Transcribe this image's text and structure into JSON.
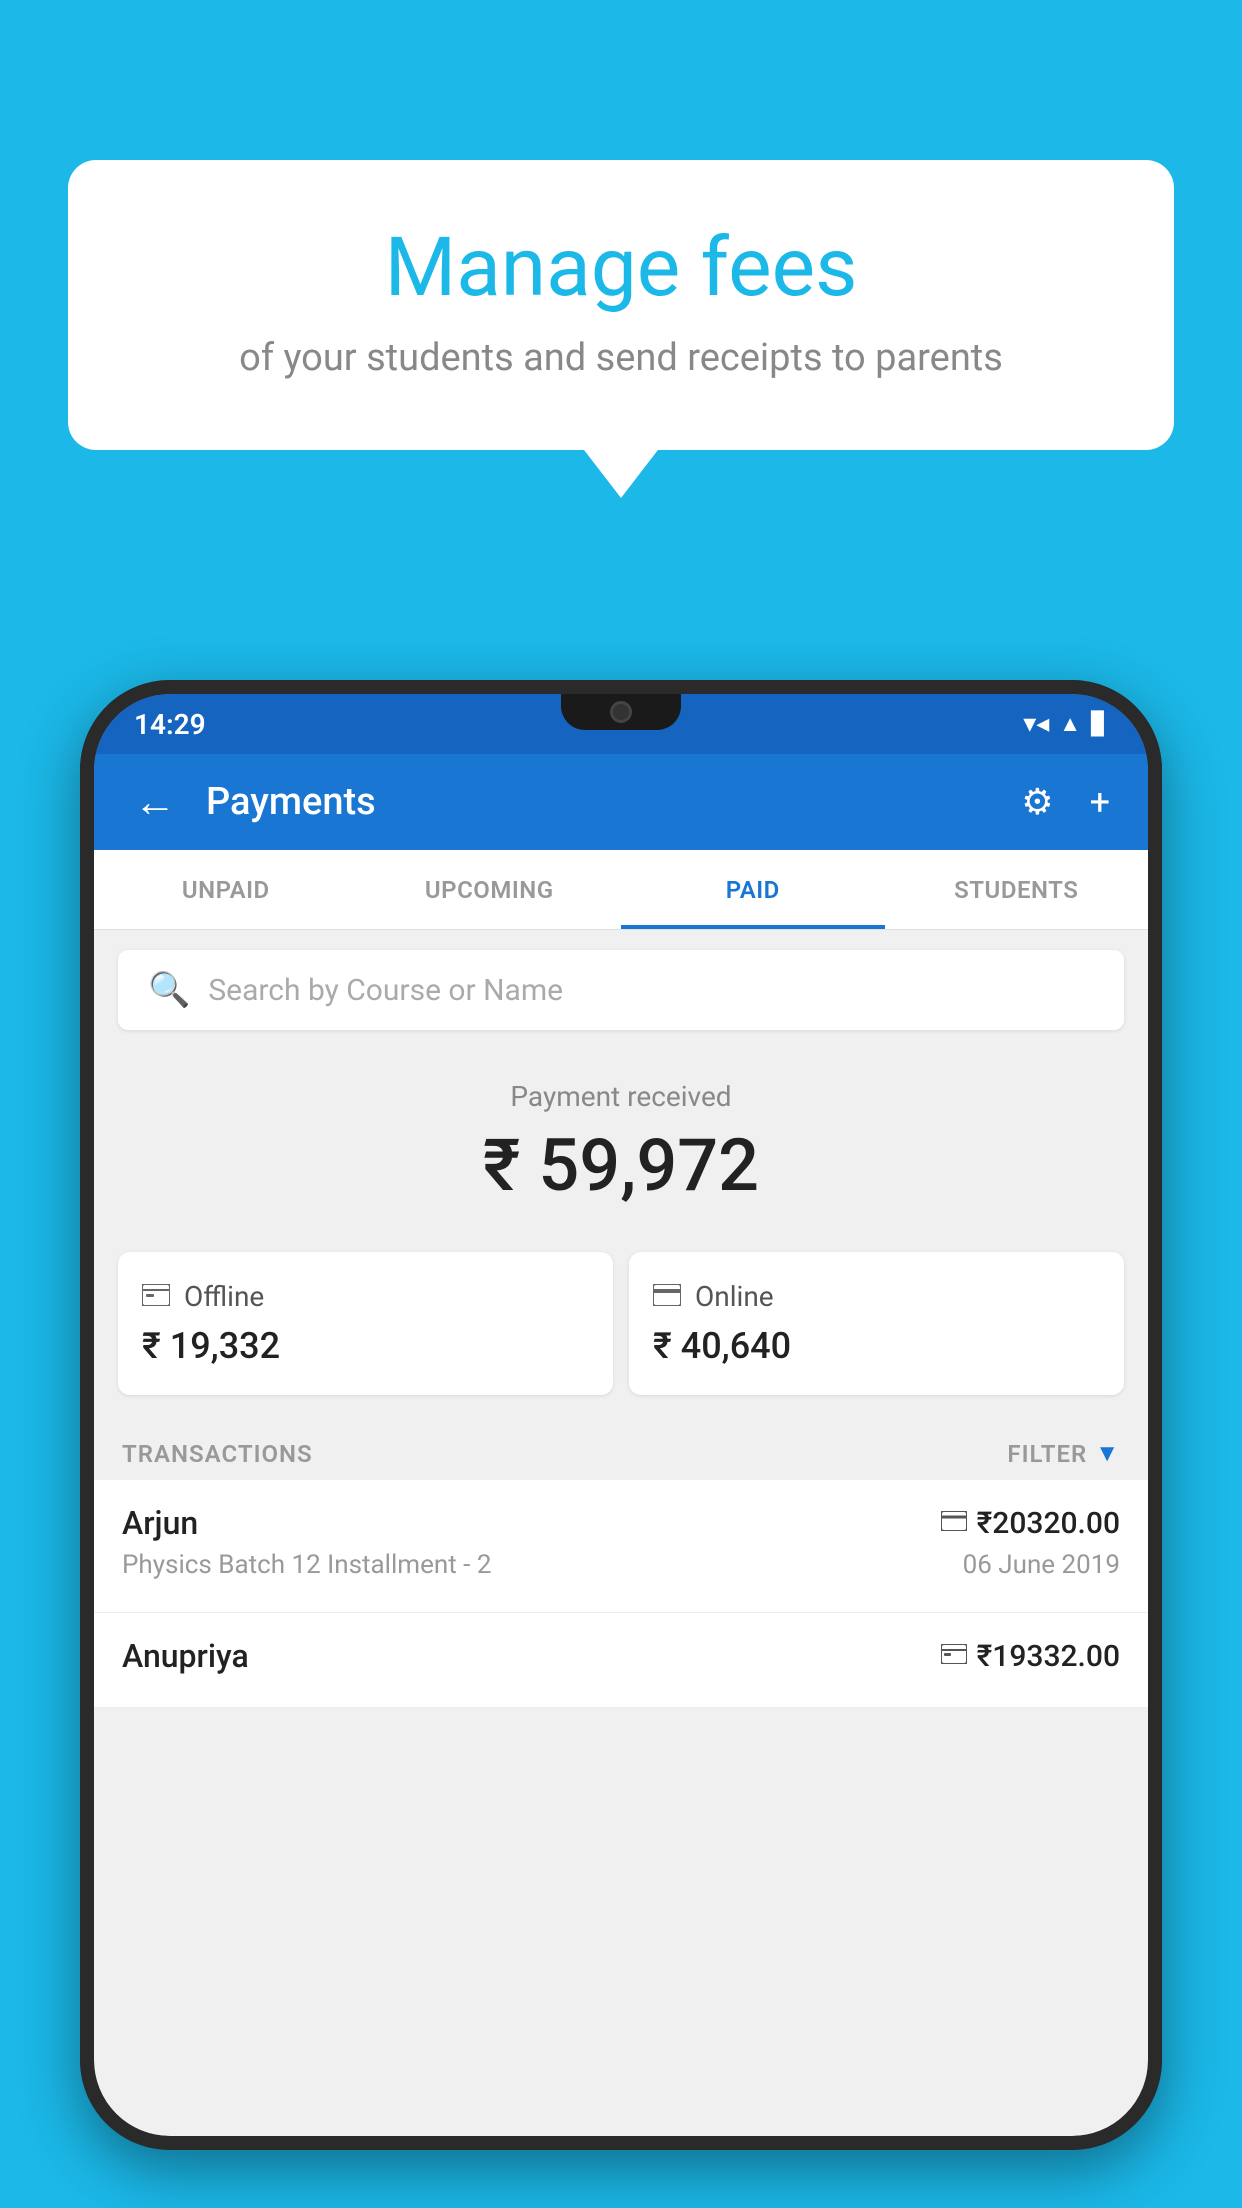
{
  "background_color": "#1BB8E8",
  "speech_bubble": {
    "title": "Manage fees",
    "subtitle": "of your students and send receipts to parents"
  },
  "status_bar": {
    "time": "14:29",
    "wifi": "▼",
    "signal": "▲",
    "battery": "▊"
  },
  "app_bar": {
    "title": "Payments",
    "back_label": "←",
    "settings_label": "⚙",
    "add_label": "+"
  },
  "tabs": [
    {
      "id": "unpaid",
      "label": "UNPAID",
      "active": false
    },
    {
      "id": "upcoming",
      "label": "UPCOMING",
      "active": false
    },
    {
      "id": "paid",
      "label": "PAID",
      "active": true
    },
    {
      "id": "students",
      "label": "STUDENTS",
      "active": false
    }
  ],
  "search": {
    "placeholder": "Search by Course or Name"
  },
  "payment_summary": {
    "received_label": "Payment received",
    "amount": "₹ 59,972",
    "offline": {
      "label": "Offline",
      "amount": "₹ 19,332"
    },
    "online": {
      "label": "Online",
      "amount": "₹ 40,640"
    }
  },
  "transactions_section": {
    "label": "TRANSACTIONS",
    "filter_label": "FILTER"
  },
  "transactions": [
    {
      "name": "Arjun",
      "detail": "Physics Batch 12 Installment - 2",
      "amount": "₹20320.00",
      "date": "06 June 2019",
      "payment_type": "online"
    },
    {
      "name": "Anupriya",
      "detail": "",
      "amount": "₹19332.00",
      "date": "",
      "payment_type": "offline"
    }
  ]
}
